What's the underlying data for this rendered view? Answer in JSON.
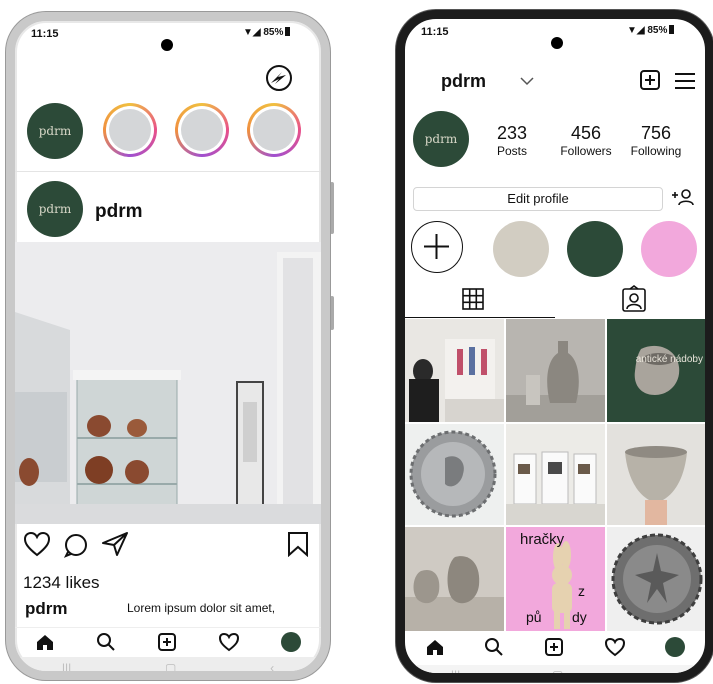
{
  "left_phone": {
    "status": {
      "time": "11:15",
      "battery": "85%"
    },
    "brand": "pdrm",
    "post": {
      "username": "pdrm",
      "likes": "1234 likes",
      "caption_user": "pdrm",
      "caption_text": "Lorem ipsum dolor sit amet,"
    },
    "nav_icons": [
      "home-icon",
      "search-icon",
      "add-post-icon",
      "heart-icon",
      "profile-avatar"
    ]
  },
  "right_phone": {
    "status": {
      "time": "11:15",
      "battery": "85%"
    },
    "username": "pdrm",
    "brand": "pdrm",
    "stats": {
      "posts_count": "233",
      "posts_label": "Posts",
      "followers_count": "456",
      "followers_label": "Followers",
      "following_count": "756",
      "following_label": "Following"
    },
    "edit_profile": "Edit profile",
    "highlight_colors": [
      "#d2cdc2",
      "#2c4a38",
      "#f2a8dc"
    ],
    "grid": {
      "tile3_text": "antické nádoby",
      "tile8_title": "hračky",
      "tile8_z": "z",
      "tile8_pu": "pů",
      "tile8_dy": "dy"
    }
  },
  "colors": {
    "brand_green": "#2c4a38",
    "pink": "#f2a8dc",
    "beige": "#d2cdc2"
  }
}
